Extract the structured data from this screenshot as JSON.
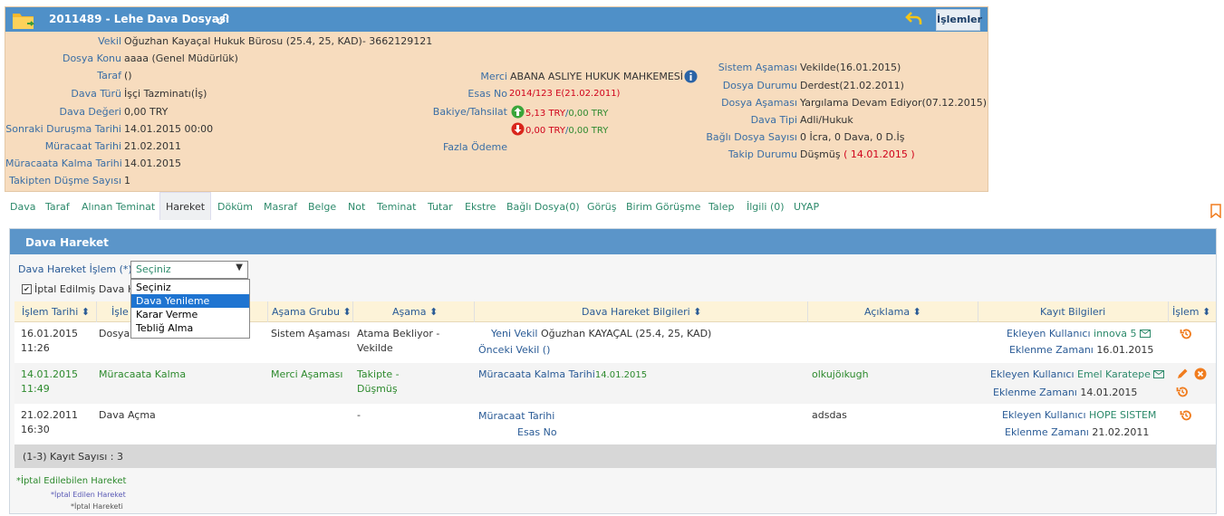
{
  "header": {
    "title": "2011489 - Lehe Dava Dosyası",
    "actions_label": "İşlemler"
  },
  "left_fields": [
    {
      "label": "Vekil",
      "value": "Oğuzhan Kayaçal Hukuk Bürosu  (25.4, 25, KAD)- 3662129121"
    },
    {
      "label": "Dosya Konu",
      "value": "aaaa (Genel Müdürlük)"
    },
    {
      "label": "Taraf",
      "value": " ()"
    },
    {
      "label": "Dava Türü",
      "value": "İşçi Tazminatı(İş)"
    },
    {
      "label": "Dava Değeri",
      "value": "0,00 TRY"
    },
    {
      "label": "Sonraki Duruşma Tarihi",
      "value": "14.01.2015 00:00"
    },
    {
      "label": "Müracaat Tarihi",
      "value": "21.02.2011"
    },
    {
      "label": "Müracaata Kalma Tarihi",
      "value": "14.01.2015"
    },
    {
      "label": "Takipten Düşme Sayısı",
      "value": "1"
    }
  ],
  "middle": {
    "merci_label": "Merci",
    "merci_value": "ABANA ASLIYE HUKUK MAHKEMESİ",
    "esas_label": "Esas No",
    "esas_value": "2014/123 E(21.02.2011)",
    "bakiye_label": "Bakiye/Tahsilat",
    "up_amount": "5,13 TRY",
    "up_sep": "/",
    "up_total": "0,00 TRY",
    "down_amount": "0,00 TRY",
    "down_sep": "/",
    "down_total": "0,00 TRY",
    "fazla_label": "Fazla Ödeme"
  },
  "right_fields": [
    {
      "label": "Sistem Aşaması",
      "value": "Vekilde(16.01.2015)"
    },
    {
      "label": "Dosya Durumu",
      "value": "Derdest(21.02.2011)"
    },
    {
      "label": "Dosya Aşaması",
      "value": "Yargılama Devam Ediyor(07.12.2015)"
    },
    {
      "label": "Dava Tipi",
      "value": "Adli/Hukuk"
    },
    {
      "label": "Bağlı Dosya Sayısı",
      "value": "0 İcra, 0 Dava, 0 D.İş"
    },
    {
      "label": "Takip Durumu",
      "value": "Düşmüş",
      "extra": "( 14.01.2015 )"
    }
  ],
  "tabs": [
    "Dava",
    "Taraf",
    "Alınan Teminat",
    "Hareket",
    "Döküm",
    "Masraf",
    "Belge",
    "Not",
    "Teminat",
    "Tutar",
    "Ekstre",
    "Bağlı Dosya(0)",
    "Görüş",
    "Birim Görüşme",
    "Talep",
    "İlgili (0)",
    "UYAP"
  ],
  "active_tab": "Hareket",
  "panel": {
    "title": "Dava Hareket",
    "filter_label": "Dava Hareket İşlem (*)",
    "select_value": "Seçiniz",
    "checkbox_label": "İptal Edilmiş Dava H",
    "options": [
      "Seçiniz",
      "Dava Yenileme",
      "Karar Verme",
      "Tebliğ Alma"
    ],
    "selected_option": "Dava Yenileme"
  },
  "columns": [
    "İşlem Tarihi ⬍",
    "İşle",
    "Aşama Grubu ⬍",
    "Aşama ⬍",
    "Dava Hareket Bilgileri ⬍",
    "Açıklama ⬍",
    "Kayıt Bilgileri",
    "İşlem ⬍"
  ],
  "rows": [
    {
      "date": "16.01.2015",
      "time": "11:26",
      "type": "Dosya A",
      "group": "Sistem Aşaması",
      "stage1": "Atama Bekliyor -",
      "stage2": "Vekilde",
      "info1_label": "Yeni Vekil",
      "info1_value": "Oğuzhan KAYAÇAL (25.4, 25, KAD)",
      "info2_label": "Önceki Vekil",
      "info2_value": "()",
      "desc": "",
      "user_label": "Ekleyen Kullanıcı",
      "user": "innova 5",
      "time_label": "Eklenme Zamanı",
      "added": "16.01.2015"
    },
    {
      "date": "14.01.2015",
      "time": "11:49",
      "type": "Müracaata Kalma",
      "group": "Merci Aşaması",
      "stage1": "Takipte -",
      "stage2": "Düşmüş",
      "info1_label": "Müracaata Kalma Tarihi",
      "info1_value": "14.01.2015",
      "info2_label": "",
      "info2_value": "",
      "desc": "olkujöıkugh",
      "user_label": "Ekleyen Kullanıcı",
      "user": "Emel Karatepe",
      "time_label": "Eklenme Zamanı",
      "added": "14.01.2015"
    },
    {
      "date": "21.02.2011",
      "time": "16:30",
      "type": "Dava Açma",
      "group": "",
      "stage1": "-",
      "stage2": "",
      "info1_label": "Müracaat Tarihi",
      "info1_value": "",
      "info2_label": "Esas No",
      "info2_value": "",
      "desc": "adsdas",
      "user_label": "Ekleyen Kullanıcı",
      "user": "HOPE SISTEM",
      "time_label": "Eklenme Zamanı",
      "added": "21.02.2011"
    }
  ],
  "footer": "(1-3) Kayıt Sayısı : 3",
  "legend": [
    "*İptal Edilebilen Hareket",
    "*İptal Edilen Hareket",
    "*İptal Hareketi"
  ],
  "colors": {
    "header_blue": "#4f90c8",
    "card_bg": "#f7dcbe",
    "accent_green": "#2d8a2d",
    "icon_orange": "#f07c1e"
  }
}
